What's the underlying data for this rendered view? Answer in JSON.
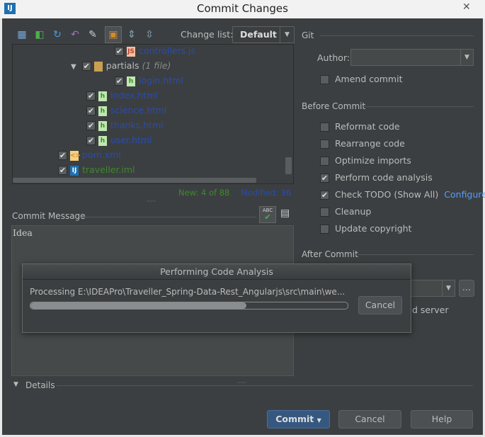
{
  "window": {
    "title": "Commit Changes",
    "close": "✕"
  },
  "toolbar": {
    "change_list_label": "Change list:",
    "change_list_value": "Default"
  },
  "tree": [
    {
      "name": "controllers.js",
      "type": "js",
      "color": "blue",
      "indent": 3
    },
    {
      "name": "partials",
      "type": "folder",
      "suffix": "(1 file)",
      "indent": 2,
      "expanded": true
    },
    {
      "name": "login.html",
      "type": "html",
      "color": "blue",
      "indent": 3
    },
    {
      "name": "index.html",
      "type": "html",
      "color": "blue",
      "indent": 2
    },
    {
      "name": "science.html",
      "type": "html",
      "color": "blue",
      "indent": 2
    },
    {
      "name": "thanks.html",
      "type": "html",
      "color": "blue",
      "indent": 2
    },
    {
      "name": "user.html",
      "type": "html",
      "color": "blue",
      "indent": 2
    },
    {
      "name": "pom.xml",
      "type": "xml",
      "color": "blue",
      "indent": 1
    },
    {
      "name": "traveller.iml",
      "type": "iml",
      "color": "green",
      "indent": 1
    }
  ],
  "status": {
    "new": "New: 4 of 88",
    "modified": "Modified: 36"
  },
  "commit_message": {
    "label": "Commit Message",
    "value": "Idea"
  },
  "git": {
    "section": "Git",
    "author_label": "Author:",
    "author_value": "",
    "amend": "Amend commit"
  },
  "before_commit": {
    "section": "Before Commit",
    "options": [
      {
        "label": "Reformat code",
        "checked": false
      },
      {
        "label": "Rearrange code",
        "checked": false
      },
      {
        "label": "Optimize imports",
        "checked": false
      },
      {
        "label": "Perform code analysis",
        "checked": true
      },
      {
        "label": "Check TODO (Show All)",
        "checked": true,
        "link": "Configure"
      },
      {
        "label": "Cleanup",
        "checked": false
      },
      {
        "label": "Update copyright",
        "checked": false
      }
    ]
  },
  "after_commit": {
    "section": "After Commit",
    "partial_text": "d server"
  },
  "progress": {
    "title": "Performing Code Analysis",
    "text": "Processing E:\\IDEAPro\\Traveller_Spring-Data-Rest_Angularjs\\src\\main\\we...",
    "percent": 68,
    "cancel": "Cancel"
  },
  "details": {
    "label": "Details"
  },
  "buttons": {
    "commit": "Commit",
    "cancel": "Cancel",
    "help": "Help"
  },
  "colors": {
    "background": "#3c3f41",
    "link": "#589df6",
    "new": "#3f8a2a",
    "modified": "#284cb0"
  }
}
